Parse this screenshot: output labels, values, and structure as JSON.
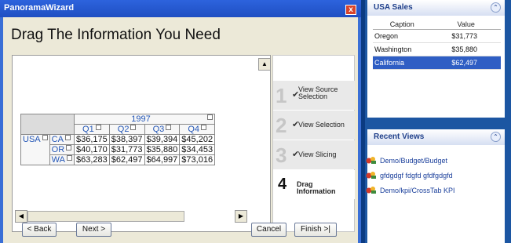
{
  "wizard": {
    "title": "PanoramaWizard",
    "close_label": "x",
    "heading": "Drag The Information You Need",
    "scroll_up": "▲",
    "scroll_left": "◀",
    "scroll_right": "▶"
  },
  "pivot": {
    "year": "1997",
    "quarters": [
      "Q1",
      "Q2",
      "Q3",
      "Q4"
    ],
    "country": "USA",
    "rows": [
      {
        "state": "CA",
        "values": [
          "$36,175",
          "$38,397",
          "$39,394",
          "$45,202"
        ]
      },
      {
        "state": "OR",
        "values": [
          "$40,170",
          "$31,773",
          "$35,880",
          "$34,453"
        ]
      },
      {
        "state": "WA",
        "values": [
          "$63,283",
          "$62,497",
          "$64,997",
          "$73,016"
        ]
      }
    ]
  },
  "steps": [
    {
      "num": "1",
      "label": "View Source Selection",
      "check": "✔"
    },
    {
      "num": "2",
      "label": "View Selection",
      "check": "✔"
    },
    {
      "num": "3",
      "label": "View Slicing",
      "check": "✔"
    },
    {
      "num": "4",
      "label": "Drag Information",
      "check": ""
    }
  ],
  "buttons": {
    "back": "< Back",
    "next": "Next >",
    "cancel": "Cancel",
    "finish": "Finish >|"
  },
  "usa_sales": {
    "title": "USA Sales",
    "collapse": "⌃",
    "columns": [
      "Caption",
      "Value"
    ],
    "rows": [
      {
        "caption": "Oregon",
        "value": "$31,773",
        "selected": false
      },
      {
        "caption": "Washington",
        "value": "$35,880",
        "selected": false
      },
      {
        "caption": "California",
        "value": "$62,497",
        "selected": true
      }
    ]
  },
  "recent_views": {
    "title": "Recent Views",
    "collapse": "⌃",
    "items": [
      "Demo/Budget/Budget",
      "gfdgdgf fdgfd gfdfgdgfd",
      "Demo/kpi/CrossTab KPI"
    ]
  },
  "colors": {
    "accent": "#1c56a2",
    "selection": "#2f5ec4",
    "title_bar": "#2d63dd",
    "close": "#d8442b"
  }
}
